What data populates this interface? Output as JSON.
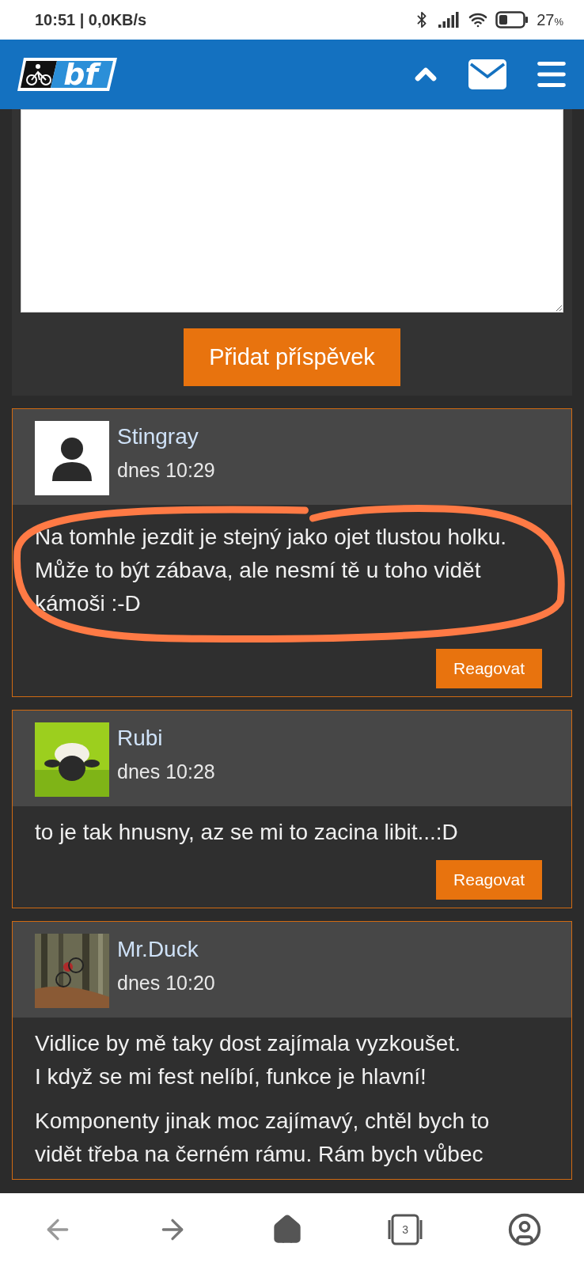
{
  "status_bar": {
    "time": "10:51 | 0,0KB/s",
    "battery": "27",
    "battery_unit": "%"
  },
  "header": {
    "logo": "bf"
  },
  "post_form": {
    "button": "Přidat příspěvek"
  },
  "comments": [
    {
      "author": "Stingray",
      "time": "dnes 10:29",
      "avatar": {
        "kind": "silhouette"
      },
      "highlighted": true,
      "paragraphs": [
        "Na tomhle jezdit je stejný jako ojet tlustou holku. Může to být zábava, ale nesmí tě u toho vidět kámoši :-D"
      ],
      "reply": "Reagovat"
    },
    {
      "author": "Rubi",
      "time": "dnes 10:28",
      "avatar": {
        "kind": "picture"
      },
      "highlighted": false,
      "paragraphs": [
        "to je tak hnusny, az se mi to zacina libit...:D"
      ],
      "reply": "Reagovat"
    },
    {
      "author": "Mr.Duck",
      "time": "dnes 10:20",
      "avatar": {
        "kind": "picture"
      },
      "highlighted": false,
      "paragraphs": [
        "Vidlice by mě taky dost zajímala vyzkoušet.\nI když se mi fest nelíbí, funkce je hlavní!",
        "Komponenty jinak moc zajímavý, chtěl bych to vidět třeba na černém rámu. Rám bych vůbec"
      ]
    }
  ],
  "bottom_nav": {
    "tab_count": "3"
  }
}
